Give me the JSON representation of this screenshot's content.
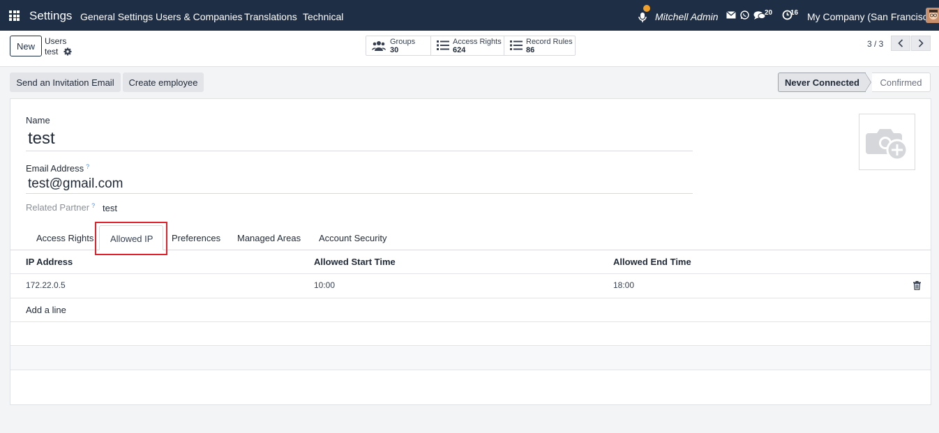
{
  "navbar": {
    "app_title": "Settings",
    "menu": [
      "General Settings",
      "Users & Companies",
      "Translations",
      "Technical"
    ],
    "user_name": "Mitchell Admin",
    "messages_count": "20",
    "activities_count": "16",
    "company": "My Company (San Francisco)",
    "accent_color": "#1e2e45"
  },
  "control": {
    "new_label": "New",
    "breadcrumb_parent": "Users",
    "breadcrumb_current": "test",
    "smart_buttons": [
      {
        "label": "Groups",
        "value": "30",
        "icon": "users-icon"
      },
      {
        "label": "Access Rights",
        "value": "624",
        "icon": "list-icon"
      },
      {
        "label": "Record Rules",
        "value": "86",
        "icon": "list-icon"
      }
    ],
    "pager": "3 / 3"
  },
  "status": {
    "actions": [
      "Send an Invitation Email",
      "Create employee"
    ],
    "current": "Never Connected",
    "next": "Confirmed"
  },
  "form": {
    "name_label": "Name",
    "name_value": "test",
    "email_label": "Email Address",
    "email_value": "test@gmail.com",
    "partner_label": "Related Partner",
    "partner_value": "test",
    "help_mark": "?"
  },
  "tabs": [
    "Access Rights",
    "Allowed IP",
    "Preferences",
    "Managed Areas",
    "Account Security"
  ],
  "active_tab": "Allowed IP",
  "table": {
    "headers": [
      "IP Address",
      "Allowed Start Time",
      "Allowed End Time"
    ],
    "rows": [
      {
        "ip": "172.22.0.5",
        "start": "10:00",
        "end": "18:00"
      }
    ],
    "add_line": "Add a line"
  }
}
